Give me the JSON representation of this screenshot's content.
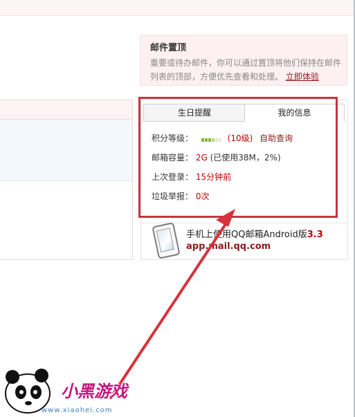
{
  "pin_tip": {
    "title": "邮件置顶",
    "description": "重要或待办邮件，你可以通过置顶将他们保持在邮件列表的顶部，方便优先查看和处理。",
    "link": "立即体验"
  },
  "tabs": [
    {
      "label": "生日提醒",
      "active": false
    },
    {
      "label": "我的信息",
      "active": true
    }
  ],
  "info": {
    "level": {
      "label": "积分等级：",
      "value": "(10级)",
      "link": "自助查询"
    },
    "capacity": {
      "label": "邮箱容量：",
      "value": "2G",
      "detail": "(已使用38M，2%)"
    },
    "last_login": {
      "label": "上次登录：",
      "value": "15分钟前"
    },
    "spam": {
      "label": "垃圾举报：",
      "value": "0次"
    }
  },
  "promo": {
    "line1": "手机上使用QQ邮箱Android版",
    "version": "3.3",
    "url": "app.mail.qq.com",
    "icon": "phone-icon"
  },
  "watermark": {
    "text": "小黑游戏",
    "url": "www.xiaohei.com"
  },
  "colors": {
    "accent_red": "#c00000",
    "link_dark_red": "#8b1a1a",
    "annotation_red": "#c9333f"
  }
}
